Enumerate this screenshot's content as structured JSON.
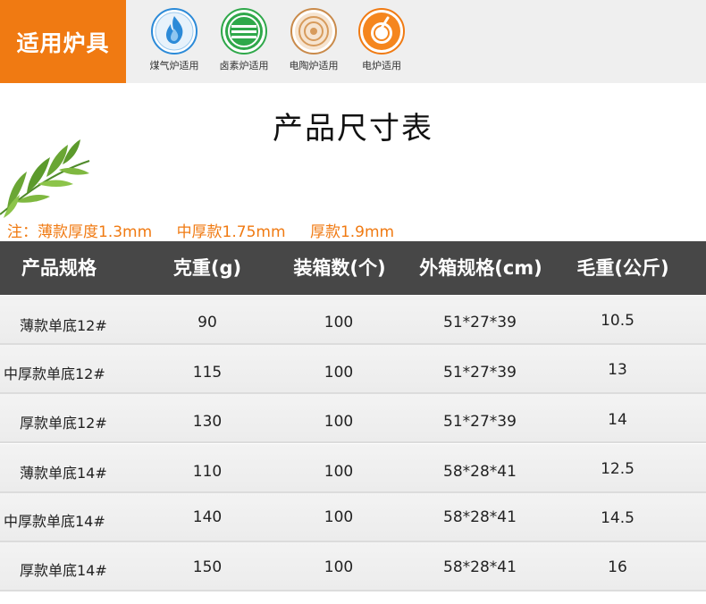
{
  "stoves": {
    "badge": "适用炉具",
    "items": [
      {
        "caption": "煤气炉适用",
        "icon": "gas-flame-icon"
      },
      {
        "caption": "卤素炉适用",
        "icon": "halogen-stove-icon"
      },
      {
        "caption": "电陶炉适用",
        "icon": "ceramic-stove-icon"
      },
      {
        "caption": "电炉适用",
        "icon": "electric-stove-icon"
      }
    ]
  },
  "title": "产品尺寸表",
  "note": {
    "prefix": "注：薄款厚度1.3mm",
    "medium": "中厚款1.75mm",
    "thick": "厚款1.9mm"
  },
  "colors": {
    "accent": "#f07a12",
    "header": "#474747"
  },
  "table": {
    "headers": [
      "产品规格",
      "克重(g)",
      "装箱数(个)",
      "外箱规格(cm)",
      "毛重(公斤)"
    ],
    "rows": [
      {
        "spec": "薄款单底12#",
        "weight": "90",
        "qty": "100",
        "box": "51*27*39",
        "gross": "10.5"
      },
      {
        "spec": "中厚款单底12#",
        "weight": "115",
        "qty": "100",
        "box": "51*27*39",
        "gross": "13"
      },
      {
        "spec": "厚款单底12#",
        "weight": "130",
        "qty": "100",
        "box": "51*27*39",
        "gross": "14"
      },
      {
        "spec": "薄款单底14#",
        "weight": "110",
        "qty": "100",
        "box": "58*28*41",
        "gross": "12.5"
      },
      {
        "spec": "中厚款单底14#",
        "weight": "140",
        "qty": "100",
        "box": "58*28*41",
        "gross": "14.5"
      },
      {
        "spec": "厚款单底14#",
        "weight": "150",
        "qty": "100",
        "box": "58*28*41",
        "gross": "16"
      }
    ]
  }
}
